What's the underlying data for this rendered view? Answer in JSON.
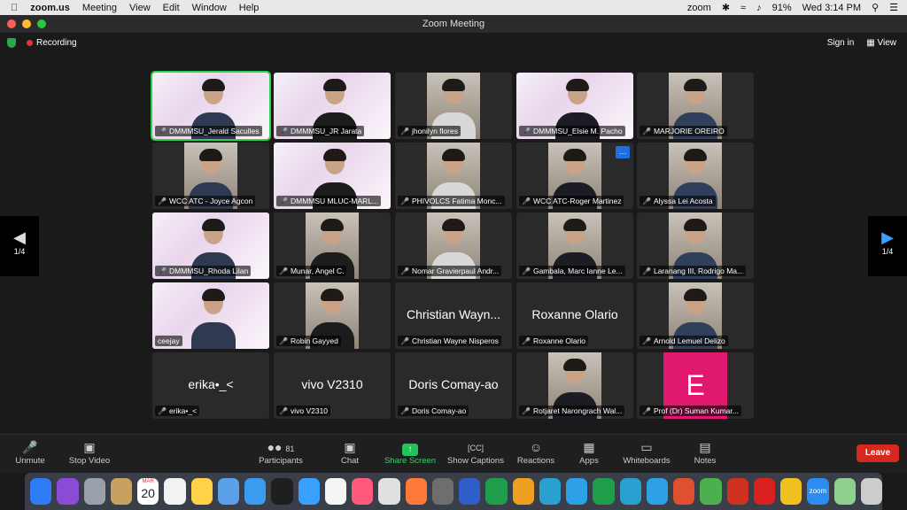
{
  "menubar": {
    "app": "zoom.us",
    "items": [
      "Meeting",
      "View",
      "Edit",
      "Window",
      "Help"
    ],
    "zoom_label": "zoom",
    "battery": "91%",
    "clock": "Wed 3:14 PM"
  },
  "window": {
    "title": "Zoom Meeting"
  },
  "topbar": {
    "recording": "Recording",
    "sign_in": "Sign in",
    "view": "View"
  },
  "paging": {
    "left": "1/4",
    "right": "1/4"
  },
  "participants": [
    {
      "name": "DMMMSU_Jerald Saculles",
      "type": "slide",
      "active": true
    },
    {
      "name": "DMMMSU_JR Jarata",
      "type": "slide"
    },
    {
      "name": "jhonilyn flores",
      "type": "video"
    },
    {
      "name": "DMMMSU_Elsie M. Pacho",
      "type": "slide"
    },
    {
      "name": "MARJORIE OREIRO",
      "type": "video"
    },
    {
      "name": "WCC ATC - Joyce Agcon",
      "type": "video"
    },
    {
      "name": "DMMMSU MLUC-MARL...",
      "type": "slide"
    },
    {
      "name": "PHIVOLCS Fatima Monc...",
      "type": "video"
    },
    {
      "name": "WCC ATC-Roger Martinez",
      "type": "video"
    },
    {
      "name": "Alyssa Lei Acosta",
      "type": "video"
    },
    {
      "name": "DMMMSU_Rhoda Lilan",
      "type": "slide"
    },
    {
      "name": "Munar, Angel C.",
      "type": "video"
    },
    {
      "name": "Nomar Gravierpaul Andr...",
      "type": "video"
    },
    {
      "name": "Gambala, Marc Ianne Le...",
      "type": "video"
    },
    {
      "name": "Laranang III, Rodrigo Ma...",
      "type": "video"
    },
    {
      "name": "ceejay",
      "type": "slide"
    },
    {
      "name": "Robin Gayyed",
      "type": "video"
    },
    {
      "name": "Christian Wayne Nisperos",
      "type": "text",
      "display": "Christian Wayn..."
    },
    {
      "name": "Roxanne Olario",
      "type": "text",
      "display": "Roxanne Olario"
    },
    {
      "name": "Arnold Lemuel Delizo",
      "type": "video"
    },
    {
      "name": "erika•_<",
      "type": "text",
      "display": "erika•_<"
    },
    {
      "name": "vivo V2310",
      "type": "text",
      "display": "vivo V2310"
    },
    {
      "name": "Doris Comay-ao",
      "type": "text",
      "display": "Doris Comay-ao"
    },
    {
      "name": "Rotjaret Narongrach Wal...",
      "type": "video"
    },
    {
      "name": "Prof (Dr) Suman Kumar...",
      "type": "letter",
      "display": "E"
    }
  ],
  "toolbar": {
    "unmute": "Unmute",
    "stop_video": "Stop Video",
    "participants": "Participants",
    "participants_count": "81",
    "chat": "Chat",
    "share_screen": "Share Screen",
    "show_captions": "Show Captions",
    "reactions": "Reactions",
    "apps": "Apps",
    "whiteboards": "Whiteboards",
    "notes": "Notes",
    "leave": "Leave"
  },
  "dock": {
    "calendar_month": "MAR",
    "calendar_day": "20",
    "zoom_label": "zoom",
    "icon_colors": [
      "#2d7df6",
      "#8a4bd6",
      "#9aa0aa",
      "#c8a060",
      "#d94040",
      "#f2f2f2",
      "#ffd24a",
      "#5ba0e8",
      "#3a9bf0",
      "#1f1f1f",
      "#3aa0ff",
      "#f5f5f5",
      "#ff5a7a",
      "#e0e0e0",
      "#ff7a3a",
      "#6e6e6e",
      "#2f5ec9",
      "#1e9e4a",
      "#f0a020",
      "#2aa0d0",
      "#2da0e8",
      "#1e9e4a",
      "#2aa0d0",
      "#2da0e8",
      "#e05030",
      "#4caf50",
      "#d03020",
      "#d82020",
      "#f0c020",
      "#2d8cf0",
      "#8fd08f",
      "#cccccc"
    ]
  }
}
